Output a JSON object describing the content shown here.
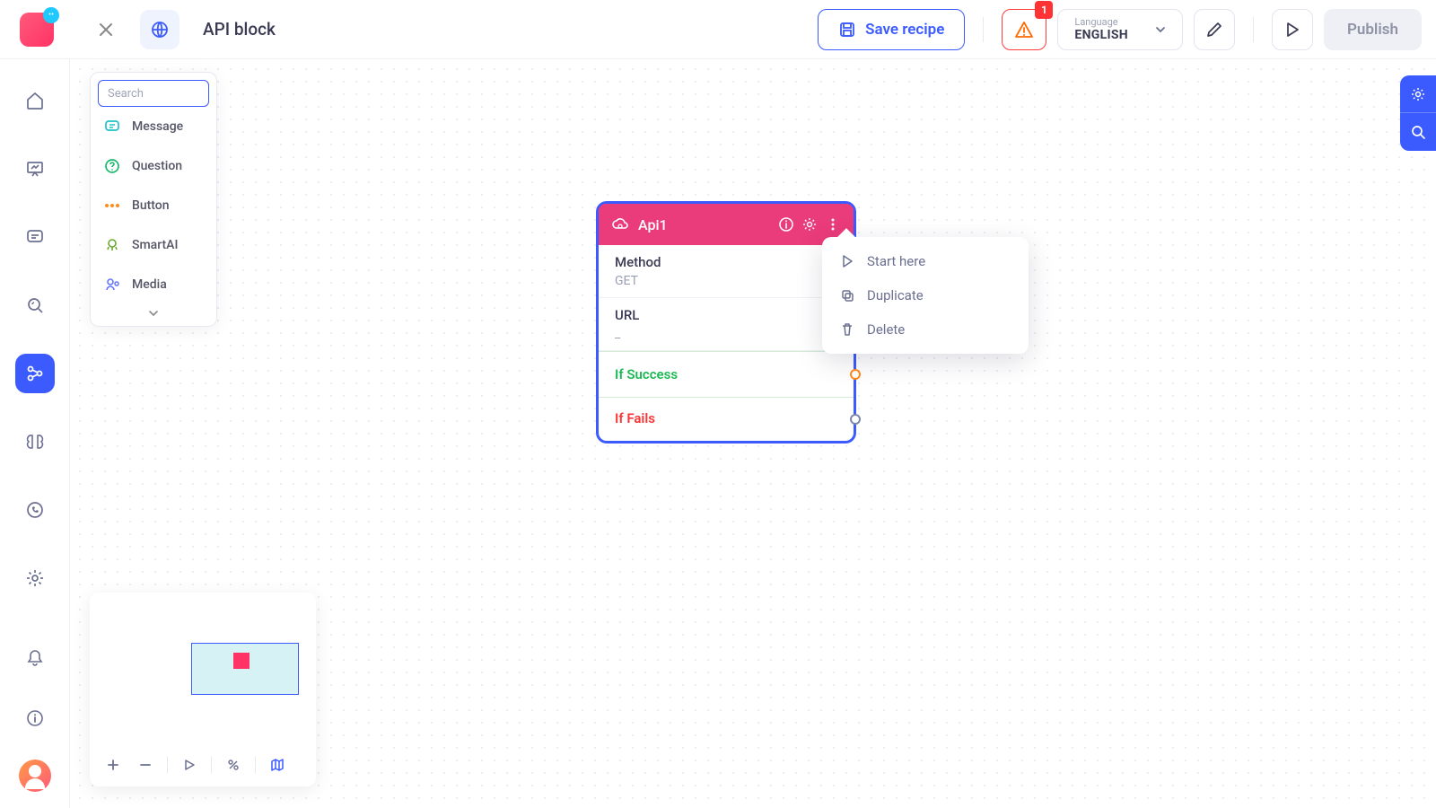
{
  "header": {
    "title": "API block",
    "save_label": "Save recipe",
    "warn_badge": "1",
    "language_label": "Language",
    "language_value": "ENGLISH",
    "publish_label": "Publish"
  },
  "palette": {
    "search_placeholder": "Search",
    "items": [
      {
        "label": "Message",
        "icon": "message",
        "color": "#1fc2c8"
      },
      {
        "label": "Question",
        "icon": "question",
        "color": "#17b86c"
      },
      {
        "label": "Button",
        "icon": "button",
        "color": "#ff8c1a"
      },
      {
        "label": "SmartAI",
        "icon": "smartai",
        "color": "#6aa92f"
      },
      {
        "label": "Media",
        "icon": "media",
        "color": "#6576ff"
      }
    ]
  },
  "node": {
    "title": "Api1",
    "method_label": "Method",
    "method_value": "GET",
    "url_label": "URL",
    "url_value": "_",
    "success_label": "If Success",
    "fails_label": "If Fails"
  },
  "context_menu": {
    "items": [
      "Start here",
      "Duplicate",
      "Delete"
    ]
  },
  "sidebar_icons": [
    "home",
    "presentation",
    "message-square",
    "zoom",
    "workflow",
    "brain",
    "whatsapp",
    "gear"
  ],
  "rail_active_index": 4,
  "bottom_icons": [
    "bell",
    "info"
  ]
}
